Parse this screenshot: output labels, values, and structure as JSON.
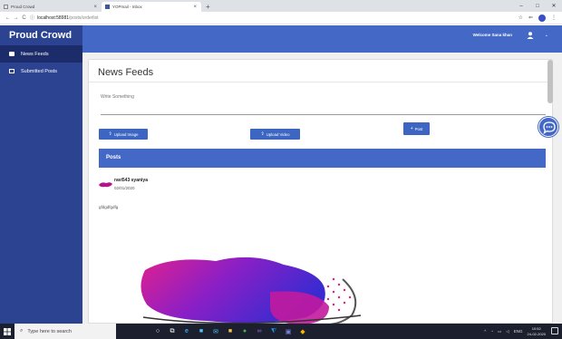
{
  "browser": {
    "tabs": [
      {
        "title": "Proud Crowd"
      },
      {
        "title": "YOPmail - Inbox"
      }
    ],
    "new_tab": "+",
    "url_host": "localhost:58981",
    "url_path": "/posts/orderlist",
    "window_controls": [
      "–",
      "□",
      "✕"
    ]
  },
  "app": {
    "brand": "Proud Crowd",
    "welcome": "Welcome Sana khan",
    "accent": "#4368c5",
    "sidebar_color": "#2b4391"
  },
  "sidebar": {
    "items": [
      {
        "label": "News Feeds",
        "icon": "feed-icon",
        "active": true
      },
      {
        "label": "Submitted Posts",
        "icon": "checkbox-icon",
        "active": false
      }
    ]
  },
  "main": {
    "title": "News Feeds",
    "write_placeholder": "Write Something",
    "upload_image": "Upload Image",
    "upload_video": "Upload Video",
    "post": "Post",
    "posts_header": "Posts"
  },
  "post": {
    "author": "ravi543 syaniya",
    "date": "02/01/2020",
    "text": "gfdgdfgdfg"
  },
  "taskbar": {
    "search_placeholder": "Type here to search",
    "lang": "ENG",
    "time": "10:52",
    "date": "24-02-2020"
  }
}
